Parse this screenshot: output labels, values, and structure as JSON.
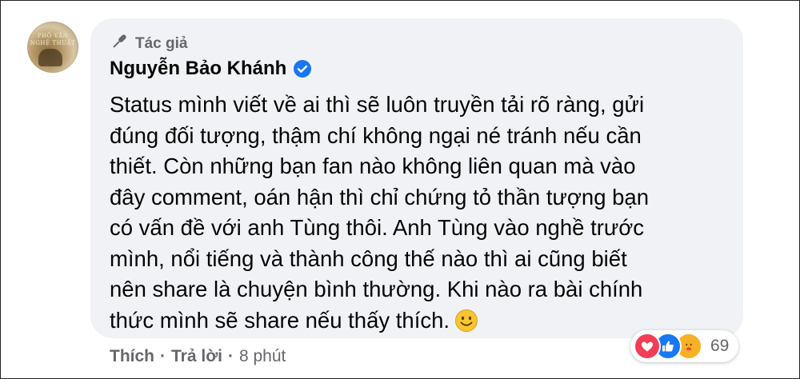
{
  "avatar": {
    "text_line1": "PHỐ VĂN",
    "text_line2": "NGHỆ THUẬT"
  },
  "comment": {
    "badge_label": "Tác giả",
    "author_name": "Nguyễn Bảo Khánh",
    "verified": true,
    "lines": [
      "Status mình viết về ai thì sẽ luôn truyền tải rõ ràng, gửi",
      "đúng đối tượng, thậm chí không ngại né tránh nếu cần",
      "thiết. Còn những bạn fan nào không liên quan mà vào",
      "đây comment, oán hận thì chỉ chứng tỏ thần tượng bạn",
      "có vấn đề với anh Tùng thôi. Anh Tùng vào nghề trước",
      "mình, nổi tiếng và thành công thế nào thì ai cũng biết",
      "nên share là chuyện bình thường. Khi nào ra bài chính",
      "thức mình sẽ share nếu thấy thích."
    ],
    "trailing_emoji": "smile-emoji"
  },
  "reactions": {
    "types": [
      "love",
      "like",
      "care"
    ],
    "count": "69"
  },
  "actions": {
    "like_label": "Thích",
    "reply_label": "Trả lời",
    "separator": "·",
    "time": "8 phút"
  },
  "colors": {
    "bubble_bg": "#f0f2f5",
    "secondary_text": "#65676b",
    "verified_blue": "#1877f2",
    "love_red": "#f33e58",
    "care_yellow": "#f7b125"
  }
}
